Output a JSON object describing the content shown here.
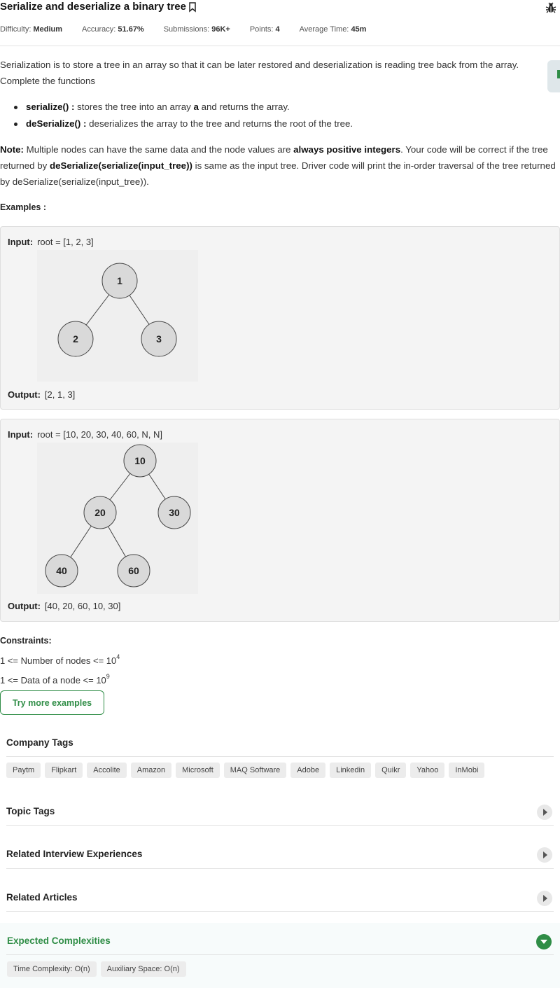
{
  "header": {
    "title": "Serialize and deserialize a binary tree",
    "meta": [
      {
        "label": "Difficulty:",
        "value": "Medium"
      },
      {
        "label": "Accuracy:",
        "value": "51.67%"
      },
      {
        "label": "Submissions:",
        "value": "96K+"
      },
      {
        "label": "Points:",
        "value": "4"
      },
      {
        "label": "Average Time:",
        "value": "45m"
      }
    ]
  },
  "description": {
    "intro": "Serialization is to store a tree in an array so that it can be later restored and deserialization is reading tree back from the array. Complete the functions",
    "bullets": [
      {
        "fn": "serialize() :",
        "text_a": " stores the tree into an array ",
        "bold": "a",
        "text_b": " and returns the array."
      },
      {
        "fn": "deSerialize() :",
        "text_a": " deserializes the array to the tree and returns the root of the tree.",
        "bold": "",
        "text_b": ""
      }
    ],
    "note": {
      "label": "Note:",
      "p1": " Multiple nodes can have the same data and the node values are ",
      "b1": "always positive integers",
      "p2": ". Your code will be correct if the tree returned by ",
      "b2": "deSerialize(serialize(input_tree))",
      "p3": " is same as the input tree. Driver code will print the in-order traversal of the tree returned by deSerialize(serialize(input_tree))."
    },
    "examples_label": "Examples :"
  },
  "examples": [
    {
      "input_label": "Input:",
      "input_value": "root = [1, 2, 3]",
      "output_label": "Output:",
      "output_value": "[2, 1, 3]",
      "nodes": [
        "1",
        "2",
        "3"
      ]
    },
    {
      "input_label": "Input:",
      "input_value": "root = [10, 20, 30, 40, 60, N, N]",
      "output_label": "Output:",
      "output_value": "[40, 20, 60, 10, 30]",
      "nodes": [
        "10",
        "20",
        "30",
        "40",
        "60"
      ]
    }
  ],
  "constraints": {
    "label": "Constraints:",
    "line1_text": "1 <= Number of nodes <= 10",
    "line1_exp": "4",
    "line2_text": "1 <= Data of a node <= 10",
    "line2_exp": "9"
  },
  "try_more": "Try more examples",
  "company_tags": {
    "title": "Company Tags",
    "items": [
      "Paytm",
      "Flipkart",
      "Accolite",
      "Amazon",
      "Microsoft",
      "MAQ Software",
      "Adobe",
      "Linkedin",
      "Quikr",
      "Yahoo",
      "InMobi"
    ]
  },
  "sections": {
    "topic_tags": "Topic Tags",
    "related_interview": "Related Interview Experiences",
    "related_articles": "Related Articles"
  },
  "complexities": {
    "title": "Expected Complexities",
    "time": "Time Complexity: O(n)",
    "space": "Auxiliary Space: O(n)"
  },
  "colors": {
    "accent": "#2f8d46",
    "node_fill": "#d9d9d9"
  }
}
